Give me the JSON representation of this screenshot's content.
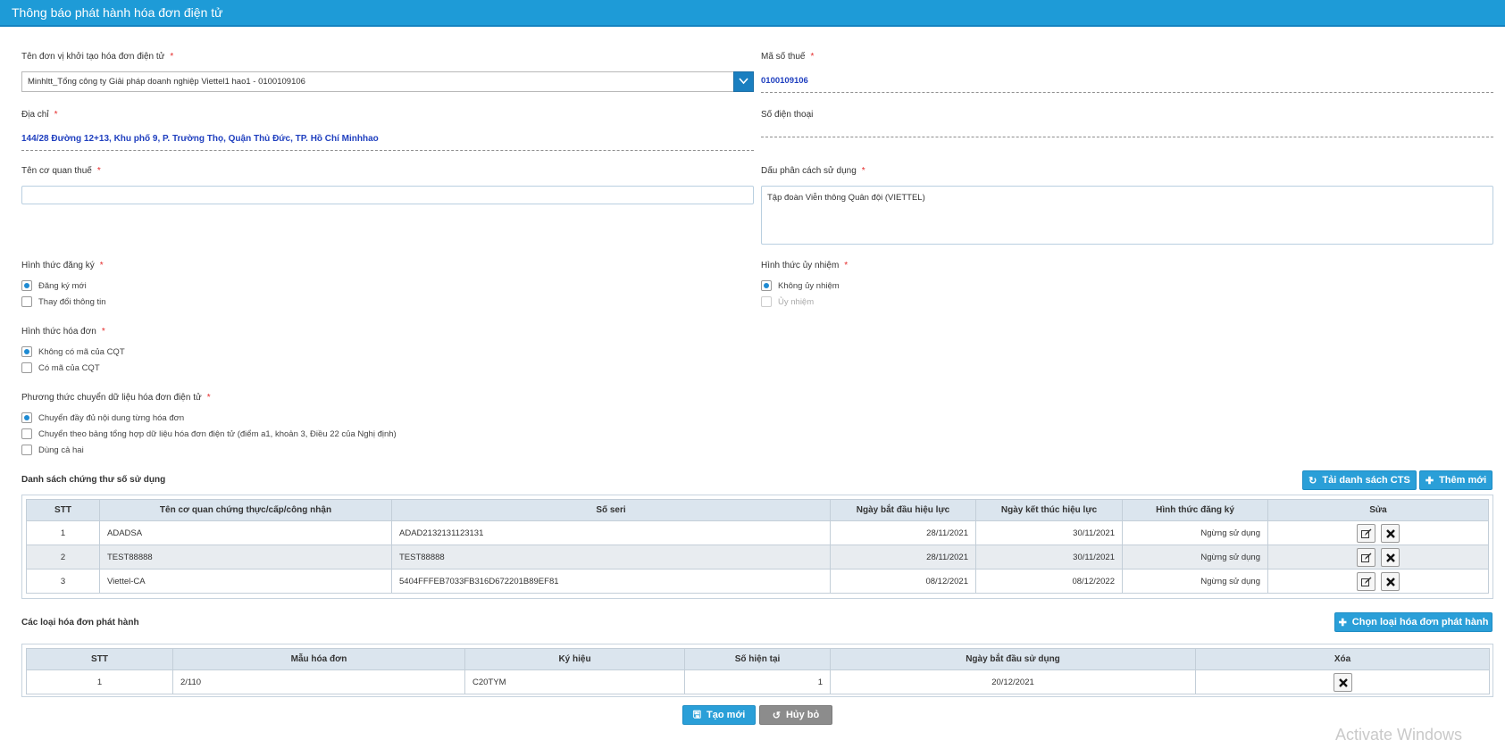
{
  "header": {
    "title": "Thông báo phát hành hóa đơn điện tử"
  },
  "form": {
    "org_label": "Tên đơn vị khởi tạo hóa đơn điện tử",
    "org_value": "Minhltt_Tổng công ty Giải pháp doanh nghiệp Viettel1 hao1 - 0100109106",
    "tax_code_label": "Mã số thuế",
    "tax_code_value": "0100109106",
    "address_label": "Địa chỉ",
    "address_value": "144/28 Đường 12+13, Khu phố 9, P. Trường Thọ, Quận Thủ Đức, TP. Hồ Chí Minhhao",
    "phone_label": "Số điện thoại",
    "phone_value": "",
    "tax_office_label": "Tên cơ quan thuế",
    "tax_office_value": "",
    "separator_label": "Dấu phân cách sử dụng",
    "separator_value": "Tập đoàn Viễn thông Quân đội (VIETTEL)",
    "required_mark": "*",
    "reg_type": {
      "label": "Hình thức đăng ký",
      "options": [
        {
          "label": "Đăng ký mới",
          "checked": true
        },
        {
          "label": "Thay đổi thông tin",
          "checked": false
        }
      ]
    },
    "delegation": {
      "label": "Hình thức ủy nhiệm",
      "options": [
        {
          "label": "Không ủy nhiệm",
          "checked": true
        },
        {
          "label": "Ủy nhiệm",
          "checked": false,
          "disabled": true
        }
      ]
    },
    "invoice_type": {
      "label": "Hình thức hóa đơn",
      "options": [
        {
          "label": "Không có mã của CQT",
          "checked": true
        },
        {
          "label": "Có mã của CQT",
          "checked": false
        }
      ]
    },
    "transfer_method": {
      "label": "Phương thức chuyển dữ liệu hóa đơn điện tử",
      "options": [
        {
          "label": "Chuyển đầy đủ nội dung từng hóa đơn",
          "checked": true
        },
        {
          "label": "Chuyển theo bảng tổng hợp dữ liệu hóa đơn điện tử (điểm a1, khoản 3, Điều 22 của Nghị định)",
          "checked": false
        },
        {
          "label": "Dùng cả hai",
          "checked": false
        }
      ]
    }
  },
  "certs": {
    "title": "Danh sách chứng thư số sử dụng",
    "load_button": "Tải danh sách CTS",
    "add_button": "Thêm mới",
    "columns": [
      "STT",
      "Tên cơ quan chứng thực/cấp/công nhận",
      "Số seri",
      "Ngày bắt đầu hiệu lực",
      "Ngày kết thúc hiệu lực",
      "Hình thức đăng ký",
      "Sửa"
    ],
    "rows": [
      [
        "1",
        "ADADSA",
        "ADAD2132131123131",
        "28/11/2021",
        "30/11/2021",
        "Ngừng sử dụng"
      ],
      [
        "2",
        "TEST88888",
        "TEST88888",
        "28/11/2021",
        "30/11/2021",
        "Ngừng sử dụng"
      ],
      [
        "3",
        "Viettel-CA",
        "5404FFFEB7033FB316D672201B89EF81",
        "08/12/2021",
        "08/12/2022",
        "Ngừng sử dụng"
      ]
    ]
  },
  "invoices": {
    "title": "Các loại hóa đơn phát hành",
    "choose_button": "Chọn loại hóa đơn phát hành",
    "columns": [
      "STT",
      "Mẫu hóa đơn",
      "Ký hiệu",
      "Số hiện tại",
      "Ngày bắt đầu sử dụng",
      "Xóa"
    ],
    "rows": [
      [
        "1",
        "2/110",
        "C20TYM",
        "1",
        "20/12/2021"
      ]
    ]
  },
  "footer": {
    "create_button": "Tạo mới",
    "cancel_button": "Hủy bỏ"
  },
  "watermark": "Activate Windows",
  "colors": {
    "header": "#1e9bd7",
    "accent": "#2a9fd8",
    "required": "#e52b2b",
    "value_blue": "#1f3fbf"
  }
}
